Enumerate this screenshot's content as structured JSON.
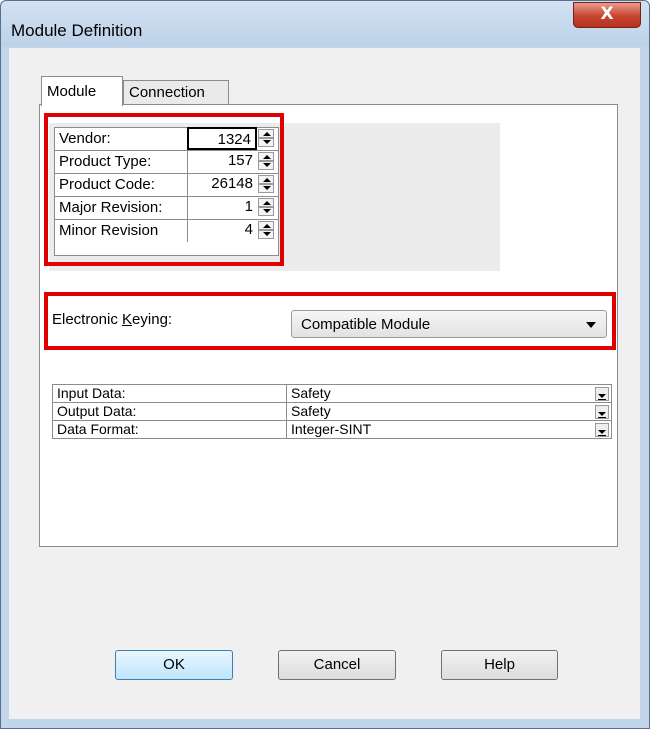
{
  "window": {
    "title": "Module Definition",
    "close_glyph": "X"
  },
  "tabs": [
    {
      "label": "Module",
      "active": true
    },
    {
      "label": "Connection",
      "active": false
    }
  ],
  "identity": {
    "rows": [
      {
        "label": "Vendor:",
        "value": "1324"
      },
      {
        "label": "Product Type:",
        "value": "157"
      },
      {
        "label": "Product Code:",
        "value": "26148"
      },
      {
        "label": "Major Revision:",
        "value": "1"
      },
      {
        "label": "Minor Revision",
        "value": "4"
      }
    ]
  },
  "keying": {
    "label_pre": "Electronic ",
    "label_accel": "K",
    "label_post": "eying:",
    "value": "Compatible Module"
  },
  "data_table": {
    "rows": [
      {
        "label": "Input Data:",
        "value": "Safety"
      },
      {
        "label": "Output Data:",
        "value": "Safety"
      },
      {
        "label": "Data Format:",
        "value": "Integer-SINT"
      }
    ]
  },
  "buttons": {
    "ok": "OK",
    "cancel": "Cancel",
    "help": "Help"
  },
  "highlight_color": "#e00000"
}
